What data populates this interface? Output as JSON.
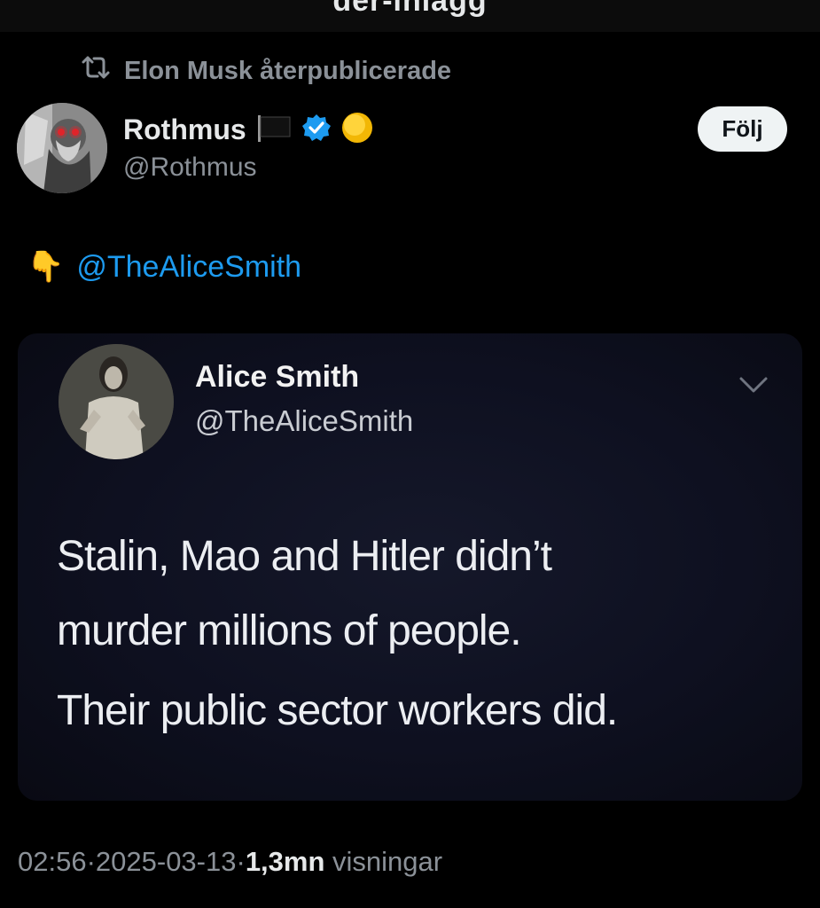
{
  "header": {
    "title": "der-inlägg"
  },
  "repost": {
    "text": "Elon Musk återpublicerade",
    "icon": "repost-icon"
  },
  "author": {
    "name": "Rothmus",
    "handle": "@Rothmus",
    "flag_icon": "black-flag-icon",
    "verified_icon": "verified-badge-icon",
    "extra_icon": "yellow-circle-icon",
    "verified_color": "#1d9bf0"
  },
  "follow": {
    "label": "Följ"
  },
  "post": {
    "emoji": "👇",
    "mention": "@TheAliceSmith"
  },
  "quoted": {
    "name": "Alice Smith",
    "handle": "@TheAliceSmith",
    "line1": "Stalin, Mao and Hitler didn’t",
    "line2": "murder millions of people.",
    "line3": "Their public sector workers did."
  },
  "footer": {
    "time": "02:56",
    "sep1": " · ",
    "date": "2025-03-13",
    "sep2": " · ",
    "views_count": "1,3mn",
    "views_label": " visningar"
  },
  "colors": {
    "accent": "#1d9bf0",
    "background": "#000000",
    "muted": "#8b9198"
  }
}
